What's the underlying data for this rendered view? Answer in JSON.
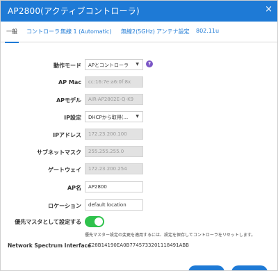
{
  "window": {
    "title": "AP2800(アクティブコントローラ)",
    "close_glyph": "×"
  },
  "tabs": [
    {
      "label": "一般",
      "active": true
    },
    {
      "label": "コントローラ",
      "active": false
    },
    {
      "label": "無線 1 (Automatic)",
      "active": false
    },
    {
      "label": "無線2(5GHz)",
      "active": false
    },
    {
      "label": "アンテナ設定",
      "active": false
    },
    {
      "label": "802.11u",
      "active": false
    }
  ],
  "form": {
    "mode": {
      "label": "動作モード",
      "value": "APとコントローラ"
    },
    "ap_mac": {
      "label": "AP Mac",
      "value": "cc:16:7e:a6:0f:8x"
    },
    "ap_model": {
      "label": "APモデル",
      "value": "AIR-AP2802E-Q-K9"
    },
    "ip_setting": {
      "label": "IP設定",
      "value": "DHCPから取得(..."
    },
    "ip_address": {
      "label": "IPアドレス",
      "value": "172.23.200.100"
    },
    "subnet": {
      "label": "サブネットマスク",
      "value": "255.255.255.0"
    },
    "gateway": {
      "label": "ゲートウェイ",
      "value": "172.23.200.254"
    },
    "ap_name": {
      "label": "AP名",
      "value": "AP2800"
    },
    "location": {
      "label": "ロケーション",
      "value": "default location"
    },
    "preferred_master": {
      "label": "優先マスタとして設定する",
      "enabled": true
    },
    "note": "優先マスター設定の変更を適用するには、設定を保存してコントローラをリセットします。",
    "nsi": {
      "label": "Network Spectrum Interface",
      "value": "C28B14190EA0B7745733201118491ABB"
    }
  },
  "colors": {
    "accent": "#1e7ad6",
    "toggle_on": "#2fc24c",
    "help": "#7b56c6"
  }
}
